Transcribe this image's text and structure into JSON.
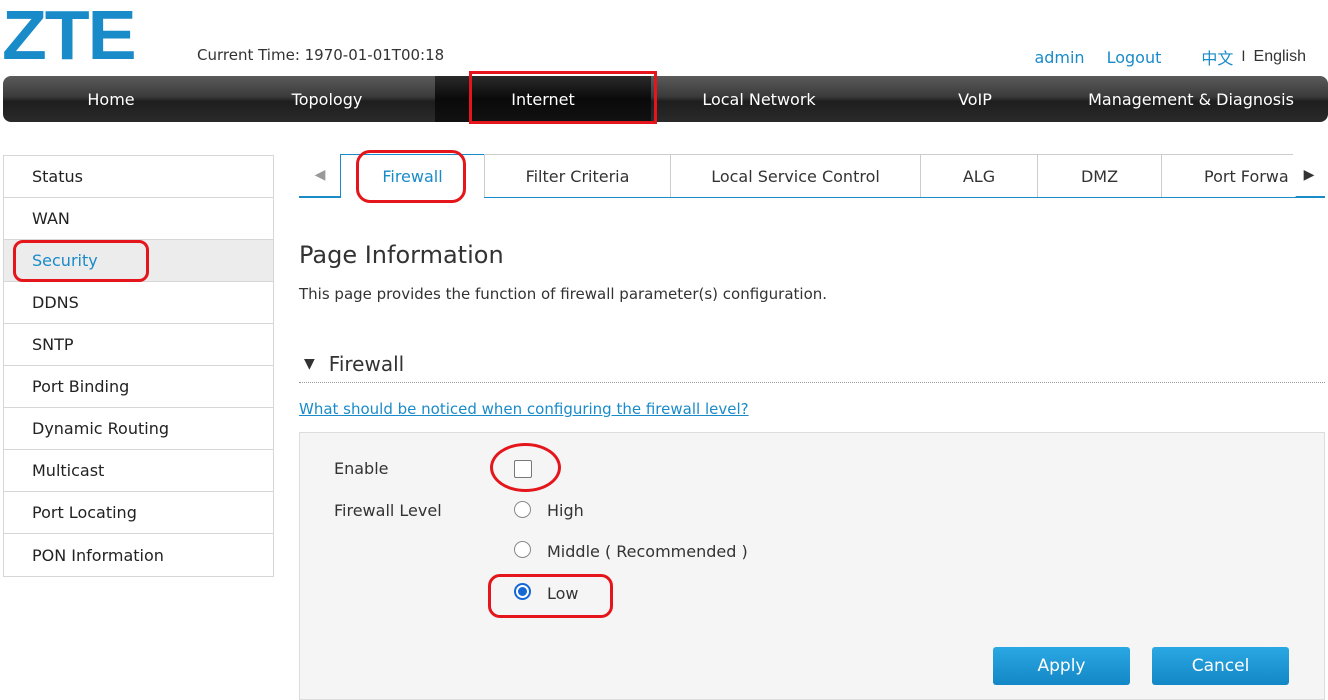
{
  "header": {
    "logo_text": "ZTE",
    "current_time_label": "Current Time: 1970-01-01T00:18",
    "user": "admin",
    "logout": "Logout",
    "lang_zh": "中文",
    "lang_sep": "I",
    "lang_en": "English"
  },
  "nav": {
    "items": [
      "Home",
      "Topology",
      "Internet",
      "Local Network",
      "VoIP",
      "Management & Diagnosis"
    ],
    "active": "Internet"
  },
  "sidebar": {
    "items": [
      "Status",
      "WAN",
      "Security",
      "DDNS",
      "SNTP",
      "Port Binding",
      "Dynamic Routing",
      "Multicast",
      "Port Locating",
      "PON Information"
    ],
    "active": "Security"
  },
  "tabs": {
    "prev_icon": "◀",
    "next_icon": "▶",
    "items": [
      "Firewall",
      "Filter Criteria",
      "Local Service Control",
      "ALG",
      "DMZ",
      "Port Forwa"
    ],
    "active": "Firewall"
  },
  "page": {
    "title": "Page Information",
    "description": "This page provides the function of firewall parameter(s) configuration."
  },
  "section": {
    "toggle_icon": "▼",
    "title": "Firewall",
    "help_link": "What should be noticed when configuring the firewall level?"
  },
  "form": {
    "enable_label": "Enable",
    "enable_checked": false,
    "level_label": "Firewall Level",
    "levels": [
      "High",
      "Middle ( Recommended )",
      "Low"
    ],
    "selected_level": "Low",
    "apply_label": "Apply",
    "cancel_label": "Cancel"
  },
  "colors": {
    "accent": "#1a8bc9",
    "annotation_red": "#e4161b",
    "radio_selected": "#1468d6"
  }
}
